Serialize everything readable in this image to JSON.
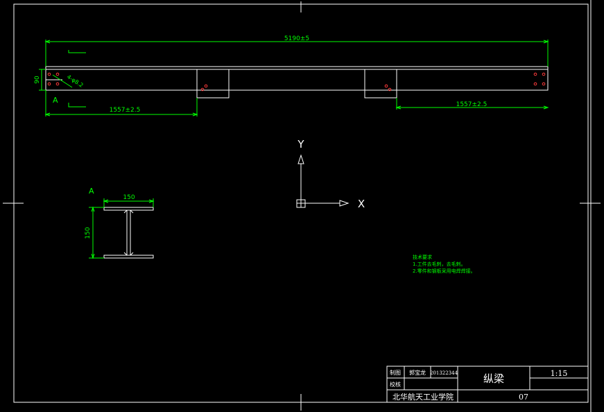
{
  "colors": {
    "background": "#000000",
    "outline": "#ffffff",
    "dimension": "#00ff00",
    "bolt_holes": "#ff3b3b"
  },
  "elevation": {
    "overall_length": "5190±5",
    "left_bay": "1557±2.5",
    "right_bay": "1557±2.5",
    "height": "90",
    "hole_callout": "4-φ8.2",
    "section_marker": "A"
  },
  "section_a": {
    "label": "A",
    "width": "150",
    "height": "150"
  },
  "ucs": {
    "x_label": "X",
    "y_label": "Y"
  },
  "notes": {
    "heading": "技术要求",
    "lines": [
      "1.工件去毛刺，去毛刺。",
      "2.零件和钢板采用电焊焊接。"
    ]
  },
  "title_block": {
    "drawn_label": "制图",
    "checked_label": "校核",
    "drafter": "郭宝龙",
    "student_id": "201322344",
    "part_name": "纵梁",
    "scale": "1:15",
    "school": "北华航天工业学院",
    "drawing_no": "07"
  }
}
